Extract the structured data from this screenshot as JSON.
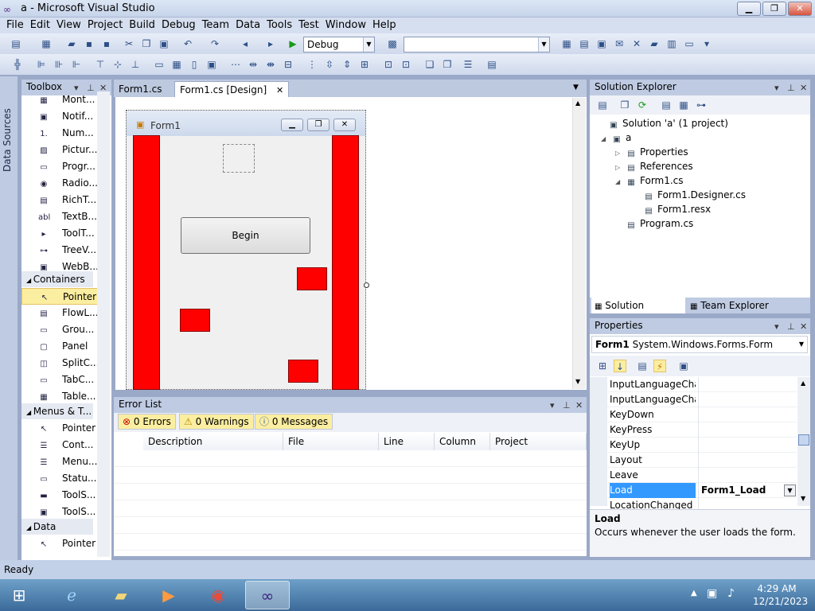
{
  "window": {
    "title": "a - Microsoft Visual Studio",
    "min": "▁",
    "max": "❐",
    "close": "✕"
  },
  "menu": [
    "File",
    "Edit",
    "View",
    "Project",
    "Build",
    "Debug",
    "Team",
    "Data",
    "Tools",
    "Test",
    "Window",
    "Help"
  ],
  "toolbar": {
    "config_value": "Debug",
    "platform_value": ""
  },
  "sidebar": {
    "data_sources_label": "Data Sources"
  },
  "toolbox": {
    "title": "Toolbox",
    "items_top": [
      {
        "icon": "calendar-icon",
        "glyph": "▦",
        "label": "Mont..."
      },
      {
        "icon": "notify-icon",
        "glyph": "▣",
        "label": "Notif..."
      },
      {
        "icon": "numeric-icon",
        "glyph": "1.",
        "label": "Num..."
      },
      {
        "icon": "picture-icon",
        "glyph": "▨",
        "label": "Pictur..."
      },
      {
        "icon": "progress-icon",
        "glyph": "▭",
        "label": "Progr..."
      },
      {
        "icon": "radio-icon",
        "glyph": "◉",
        "label": "Radio..."
      },
      {
        "icon": "richtext-icon",
        "glyph": "▤",
        "label": "RichT..."
      },
      {
        "icon": "textbox-icon",
        "glyph": "abl",
        "label": "TextB..."
      },
      {
        "icon": "tooltip-icon",
        "glyph": "▸",
        "label": "ToolT..."
      },
      {
        "icon": "treeview-icon",
        "glyph": "⊶",
        "label": "TreeV..."
      },
      {
        "icon": "webbrowser-icon",
        "glyph": "▣",
        "label": "WebB..."
      }
    ],
    "containers_label": "Containers",
    "containers": [
      {
        "icon": "pointer-icon",
        "glyph": "↖",
        "label": "Pointer",
        "selected": true
      },
      {
        "icon": "flowlayout-icon",
        "glyph": "▤",
        "label": "FlowL..."
      },
      {
        "icon": "groupbox-icon",
        "glyph": "▭",
        "label": "Grou..."
      },
      {
        "icon": "panel-icon",
        "glyph": "▢",
        "label": "Panel"
      },
      {
        "icon": "splitcontainer-icon",
        "glyph": "◫",
        "label": "SplitC..."
      },
      {
        "icon": "tabcontrol-icon",
        "glyph": "▭",
        "label": "TabC..."
      },
      {
        "icon": "tablelayout-icon",
        "glyph": "▦",
        "label": "Table..."
      }
    ],
    "menus_label": "Menus & T...",
    "menus": [
      {
        "icon": "pointer-icon",
        "glyph": "↖",
        "label": "Pointer"
      },
      {
        "icon": "contextmenu-icon",
        "glyph": "☰",
        "label": "Cont..."
      },
      {
        "icon": "menustrip-icon",
        "glyph": "☰",
        "label": "Menu..."
      },
      {
        "icon": "statusstrip-icon",
        "glyph": "▭",
        "label": "Statu..."
      },
      {
        "icon": "toolstrip-icon",
        "glyph": "▬",
        "label": "ToolS..."
      },
      {
        "icon": "toolstripcontainer-icon",
        "glyph": "▣",
        "label": "ToolS..."
      }
    ],
    "data_label": "Data",
    "data": [
      {
        "icon": "pointer-icon",
        "glyph": "↖",
        "label": "Pointer"
      }
    ]
  },
  "tabs": [
    {
      "label": "Form1.cs",
      "active": false
    },
    {
      "label": "Form1.cs [Design]",
      "active": true
    }
  ],
  "form": {
    "title": "Form1",
    "button_label": "Begin"
  },
  "errors": {
    "title": "Error List",
    "errors_btn": "0 Errors",
    "warnings_btn": "0 Warnings",
    "messages_btn": "0 Messages",
    "columns": [
      "Description",
      "File",
      "Line",
      "Column",
      "Project"
    ]
  },
  "solution": {
    "title": "Solution Explorer",
    "nodes": [
      {
        "label": "Solution 'a' (1 project)",
        "icon": "solution-icon",
        "glyph": "▣",
        "expander": ""
      },
      {
        "label": "a",
        "icon": "project-icon",
        "glyph": "▣",
        "expander": "◢"
      },
      {
        "label": "Properties",
        "icon": "properties-folder-icon",
        "glyph": "▤",
        "expander": "▷"
      },
      {
        "label": "References",
        "icon": "references-folder-icon",
        "glyph": "▤",
        "expander": "▷"
      },
      {
        "label": "Form1.cs",
        "icon": "form-file-icon",
        "glyph": "▦",
        "expander": "◢"
      },
      {
        "label": "Form1.Designer.cs",
        "icon": "cs-file-icon",
        "glyph": "▤",
        "expander": ""
      },
      {
        "label": "Form1.resx",
        "icon": "resx-file-icon",
        "glyph": "▤",
        "expander": ""
      },
      {
        "label": "Program.cs",
        "icon": "cs-file-icon",
        "glyph": "▤",
        "expander": ""
      }
    ],
    "tab_solution": "Solution Explorer",
    "tab_team": "Team Explorer"
  },
  "properties": {
    "title": "Properties",
    "object_name": "Form1",
    "object_type": "System.Windows.Forms.Form",
    "rows": [
      {
        "name": "InputLanguageChar",
        "value": ""
      },
      {
        "name": "InputLanguageChar",
        "value": ""
      },
      {
        "name": "KeyDown",
        "value": ""
      },
      {
        "name": "KeyPress",
        "value": ""
      },
      {
        "name": "KeyUp",
        "value": ""
      },
      {
        "name": "Layout",
        "value": ""
      },
      {
        "name": "Leave",
        "value": ""
      },
      {
        "name": "Load",
        "value": "Form1_Load",
        "selected": true
      },
      {
        "name": "LocationChanged",
        "value": ""
      }
    ],
    "desc_title": "Load",
    "desc_text": "Occurs whenever the user loads the form."
  },
  "status": {
    "text": "Ready"
  },
  "taskbar": {
    "time": "4:29 AM",
    "date": "12/21/2023"
  }
}
